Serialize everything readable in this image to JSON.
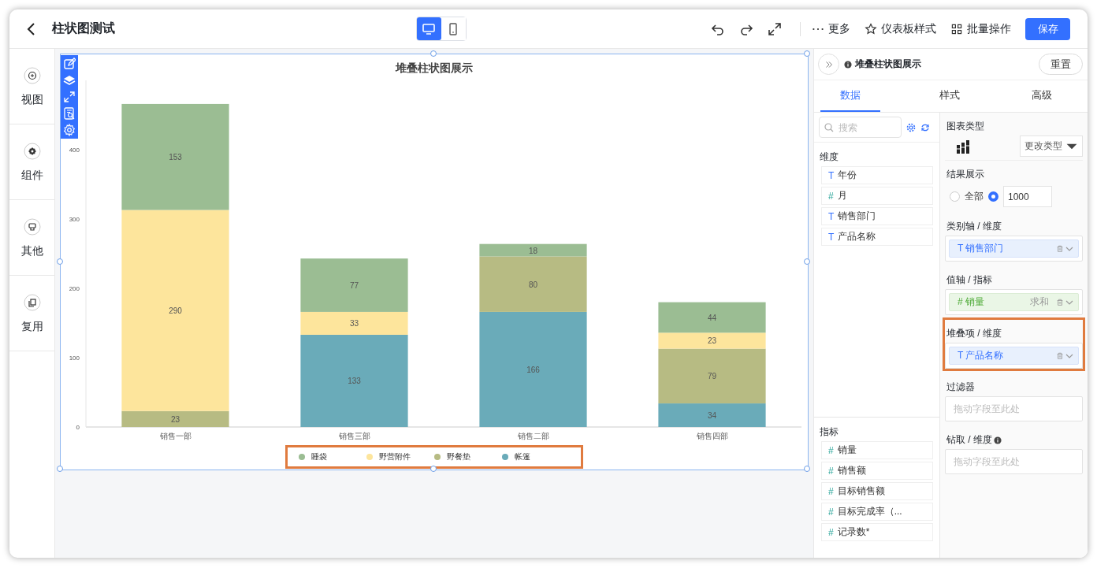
{
  "window": {
    "title": "柱状图测试"
  },
  "device_toggle": [
    {
      "kind": "desktop",
      "selected": true
    },
    {
      "kind": "mobile",
      "selected": false
    }
  ],
  "toolbar": {
    "icons": [
      {
        "kind": "undo"
      },
      {
        "kind": "redo"
      },
      {
        "kind": "fullscreen"
      }
    ],
    "actions": [
      {
        "kind": "more",
        "label": "更多"
      },
      {
        "kind": "style",
        "label": "仪表板样式"
      },
      {
        "kind": "batch",
        "label": "批量操作"
      }
    ],
    "save": "保存"
  },
  "left_rail": [
    {
      "kind": "add",
      "label": "视图"
    },
    {
      "kind": "gear",
      "label": "组件"
    },
    {
      "kind": "other",
      "label": "其他"
    },
    {
      "kind": "copy",
      "label": "复用"
    }
  ],
  "chart_card": {
    "selected": true,
    "tools": [
      {
        "kind": "edit"
      },
      {
        "kind": "layers"
      },
      {
        "kind": "expand"
      },
      {
        "kind": "inspect"
      },
      {
        "kind": "settings"
      }
    ],
    "legend_highlighted": true,
    "chart_data": {
      "type": "bar",
      "title": "堆叠柱状图展示",
      "stacked": true,
      "orientation": "vertical",
      "data_labels": true,
      "categories": [
        "销售一部",
        "销售三部",
        "销售二部",
        "销售四部"
      ],
      "ylim": [
        0,
        500
      ],
      "yticks": [
        0,
        100,
        200,
        300,
        400
      ],
      "series": [
        {
          "name": "睡袋",
          "color": "#9bbd93",
          "values": [
            153,
            77,
            18,
            44
          ]
        },
        {
          "name": "野营附件",
          "color": "#fde59c",
          "values": [
            290,
            33,
            null,
            23
          ]
        },
        {
          "name": "野餐垫",
          "color": "#b7bb83",
          "values": [
            23,
            null,
            80,
            79
          ]
        },
        {
          "name": "帐篷",
          "color": "#6aabb9",
          "values": [
            null,
            133,
            166,
            34
          ]
        }
      ]
    }
  },
  "panel": {
    "title": "堆叠柱状图展示",
    "reset": "重置",
    "tabs": [
      {
        "label": "数据",
        "selected": true
      },
      {
        "label": "样式",
        "selected": false
      },
      {
        "label": "高级",
        "selected": false
      }
    ],
    "search": {
      "placeholder": "搜索"
    },
    "dimensions": {
      "title": "维度",
      "fields": [
        {
          "kind": "dimension",
          "icon": "T",
          "name": "年份"
        },
        {
          "kind": "measure",
          "icon": "#",
          "name": "月"
        },
        {
          "kind": "dimension",
          "icon": "T",
          "name": "销售部门"
        },
        {
          "kind": "dimension",
          "icon": "T",
          "name": "产品名称"
        }
      ]
    },
    "measures": {
      "title": "指标",
      "fields": [
        {
          "kind": "measure",
          "icon": "#",
          "name": "销量"
        },
        {
          "kind": "measure",
          "icon": "#",
          "name": "销售额"
        },
        {
          "kind": "measure",
          "icon": "#",
          "name": "目标销售额"
        },
        {
          "kind": "measure",
          "icon": "#",
          "name": "目标完成率（..."
        },
        {
          "kind": "measure",
          "icon": "#",
          "name": "记录数*"
        }
      ]
    },
    "chart_type": {
      "label": "图表类型",
      "change": "更改类型"
    },
    "result": {
      "label": "结果展示",
      "options": [
        {
          "label": "全部",
          "selected": false
        },
        {
          "value": "1000",
          "selected": true
        }
      ]
    },
    "wells": [
      {
        "label": "类别轴 / 维度",
        "chip": {
          "kind": "dimension",
          "icon": "T",
          "name": "销售部门"
        }
      },
      {
        "label": "值轴 / 指标",
        "chip": {
          "kind": "measure",
          "icon": "#",
          "name": "销量",
          "aggregate": "求和"
        }
      },
      {
        "label": "堆叠项 / 维度",
        "highlighted": true,
        "chip": {
          "kind": "dimension",
          "icon": "T",
          "name": "产品名称"
        }
      },
      {
        "label": "过滤器",
        "placeholder": "拖动字段至此处"
      },
      {
        "label": "钻取 / 维度",
        "info": true,
        "placeholder": "拖动字段至此处"
      }
    ]
  }
}
